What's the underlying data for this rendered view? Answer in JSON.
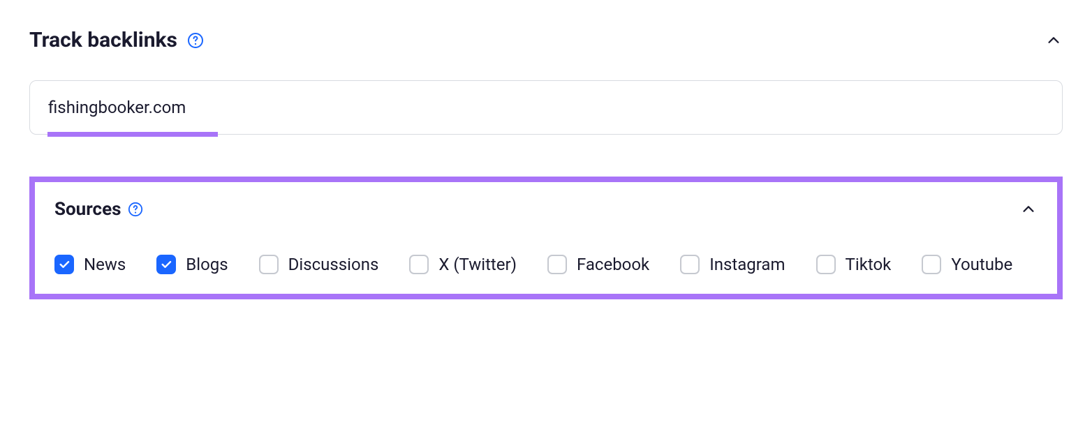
{
  "track_backlinks": {
    "title": "Track backlinks",
    "input_value": "fishingbooker.com"
  },
  "sources": {
    "title": "Sources",
    "items": [
      {
        "label": "News",
        "checked": true
      },
      {
        "label": "Blogs",
        "checked": true
      },
      {
        "label": "Discussions",
        "checked": false
      },
      {
        "label": "X (Twitter)",
        "checked": false
      },
      {
        "label": "Facebook",
        "checked": false
      },
      {
        "label": "Instagram",
        "checked": false
      },
      {
        "label": "Tiktok",
        "checked": false
      },
      {
        "label": "Youtube",
        "checked": false
      }
    ]
  },
  "colors": {
    "accent_purple": "#a874f8",
    "checkbox_blue": "#1a66ff"
  }
}
